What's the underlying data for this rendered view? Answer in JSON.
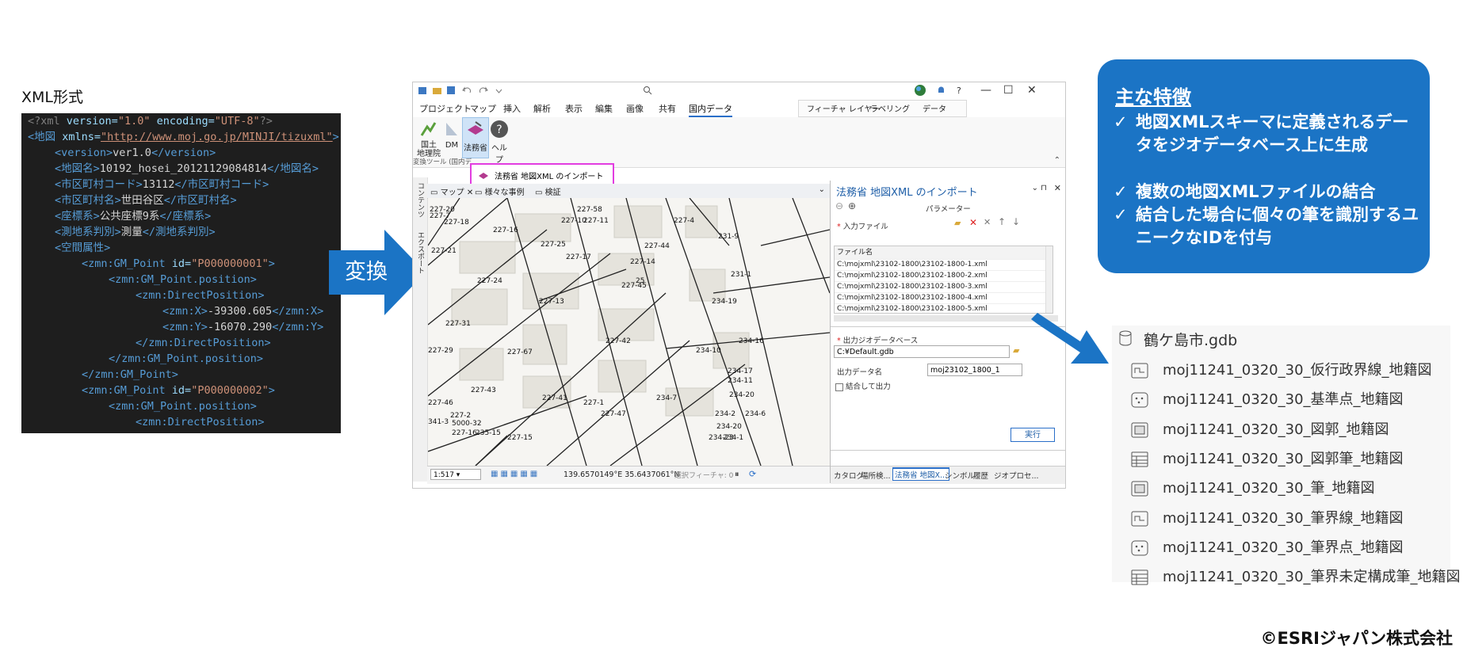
{
  "xml": {
    "title": "XML形式",
    "lines": [
      {
        "p1": "<?xml ",
        "p2": "version=",
        "p3": "\"1.0\"",
        "p4": " encoding=",
        "p5": "\"UTF-8\"",
        "p6": "?>"
      },
      {
        "p1": "<地図 ",
        "p2": "xmlns=",
        "p3": "\"http://www.moj.go.jp/MINJI/tizuxml\"",
        "p4": ">"
      },
      {
        "open": "<version>",
        "text": "ver1.0",
        "close": "</version>"
      },
      {
        "open": "<地図名>",
        "text": "10192_hosei_20121129084814",
        "close": "</地図名>"
      },
      {
        "open": "<市区町村コード>",
        "text": "13112",
        "close": "</市区町村コード>"
      },
      {
        "open": "<市区町村名>",
        "text": "世田谷区",
        "close": "</市区町村名>"
      },
      {
        "open": "<座標系>",
        "text": "公共座標9系",
        "close": "</座標系>"
      },
      {
        "open": "<測地系判別>",
        "text": "測量",
        "close": "</測地系判別>"
      },
      {
        "open": "<空間属性>"
      },
      {
        "p1": "<zmn:GM_Point ",
        "p2": "id=",
        "p3": "\"P000000001\"",
        "p4": ">"
      },
      {
        "open": "<zmn:GM_Point.position>"
      },
      {
        "open": "<zmn:DirectPosition>"
      },
      {
        "open": "<zmn:X>",
        "text": "-39300.605",
        "close": "</zmn:X>"
      },
      {
        "open": "<zmn:Y>",
        "text": "-16070.290",
        "close": "</zmn:Y>"
      },
      {
        "open": "</zmn:DirectPosition>"
      },
      {
        "open": "</zmn:GM_Point.position>"
      },
      {
        "open": "</zmn:GM_Point>"
      },
      {
        "p1": "<zmn:GM_Point ",
        "p2": "id=",
        "p3": "\"P000000002\"",
        "p4": ">"
      },
      {
        "open": "<zmn:GM_Point.position>"
      },
      {
        "open": "<zmn:DirectPosition>"
      }
    ]
  },
  "convert_label": "変換",
  "app": {
    "ribbon_tabs": [
      "プロジェクト",
      "マップ",
      "挿入",
      "解析",
      "表示",
      "編集",
      "画像",
      "共有",
      "国内データ"
    ],
    "context_tabs": [
      "フィーチャ レイヤー",
      "ラベリング",
      "データ"
    ],
    "ribbon_buttons": {
      "kokudo": "国土\n地理院",
      "dm": "DM",
      "houmu": "法務省",
      "help": "ヘルプ"
    },
    "group_label": "変換ツール (国内デ",
    "dropdown_item": "法務省 地図XML のインポート",
    "map_tabs": [
      "マップ",
      "様々な事例",
      "検証"
    ],
    "side_tabs": [
      "コンテンツ",
      "エクスポート"
    ],
    "parcels": [
      "227-20",
      "227-7",
      "227-18",
      "227-58",
      "227-10",
      "227-11",
      "227-16",
      "227-4",
      "231-9",
      "227-25",
      "227-44",
      "227-21",
      "227-17",
      "227-14",
      "231-1",
      "227-24",
      "25",
      "227-45",
      "227-13",
      "234-19",
      "227-31",
      "227-42",
      "234-16",
      "227-29",
      "227-67",
      "234-10",
      "234-17",
      "234-11",
      "227-43",
      "227-41",
      "227-1",
      "234-7",
      "234-20",
      "227-46",
      "227-47",
      "227-2",
      "234-2",
      "234-6",
      "341-3",
      "5000-32",
      "234-20",
      "227-16",
      "235-15",
      "227-15",
      "234-23",
      "234-1"
    ],
    "status": {
      "scale": "1:517",
      "coords": "139.6570149°E 35.6437061°N",
      "selected": "選択フィーチャ: 0"
    },
    "gp": {
      "title": "法務省 地図XML のインポート",
      "params": "パラメーター",
      "input_label": "入力ファイル",
      "column": "ファイル名",
      "files": [
        "C:\\mojxml\\23102-1800\\23102-1800-1.xml",
        "C:\\mojxml\\23102-1800\\23102-1800-2.xml",
        "C:\\mojxml\\23102-1800\\23102-1800-3.xml",
        "C:\\mojxml\\23102-1800\\23102-1800-4.xml",
        "C:\\mojxml\\23102-1800\\23102-1800-5.xml"
      ],
      "out_gdb_label": "出力ジオデータベース",
      "out_gdb": "C:¥Default.gdb",
      "out_name_label": "出力データ名",
      "out_name": "moj23102_1800_1",
      "merge_label": "結合して出力",
      "run": "実行",
      "bottom_tabs": [
        "カタログ",
        "場所検...",
        "法務省 地図X...",
        "シンボル",
        "履歴",
        "ジオプロセ..."
      ]
    }
  },
  "features": {
    "title": "主な特徴",
    "check": "✓",
    "items": [
      "地図XMLスキーマに定義されるデータをジオデータベース上に生成",
      "複数の地図XMLファイルの結合",
      "結合した場合に個々の筆を識別するユニークなIDを付与"
    ]
  },
  "gdb": {
    "root": "鶴ケ島市.gdb",
    "items": [
      {
        "label": "moj11241_0320_30_仮行政界線_地籍図",
        "icon": "polyline-icon"
      },
      {
        "label": "moj11241_0320_30_基準点_地籍図",
        "icon": "point-icon"
      },
      {
        "label": "moj11241_0320_30_図郭_地籍図",
        "icon": "polygon-icon"
      },
      {
        "label": "moj11241_0320_30_図郭筆_地籍図",
        "icon": "table-icon"
      },
      {
        "label": "moj11241_0320_30_筆_地籍図",
        "icon": "polygon-icon"
      },
      {
        "label": "moj11241_0320_30_筆界線_地籍図",
        "icon": "polyline-icon"
      },
      {
        "label": "moj11241_0320_30_筆界点_地籍図",
        "icon": "point-icon"
      },
      {
        "label": "moj11241_0320_30_筆界未定構成筆_地籍図",
        "icon": "table-icon"
      }
    ]
  },
  "copyright": "©ESRIジャパン株式会社",
  "colors": {
    "accent": "#1b74c5",
    "highlight": "#e23de0"
  }
}
